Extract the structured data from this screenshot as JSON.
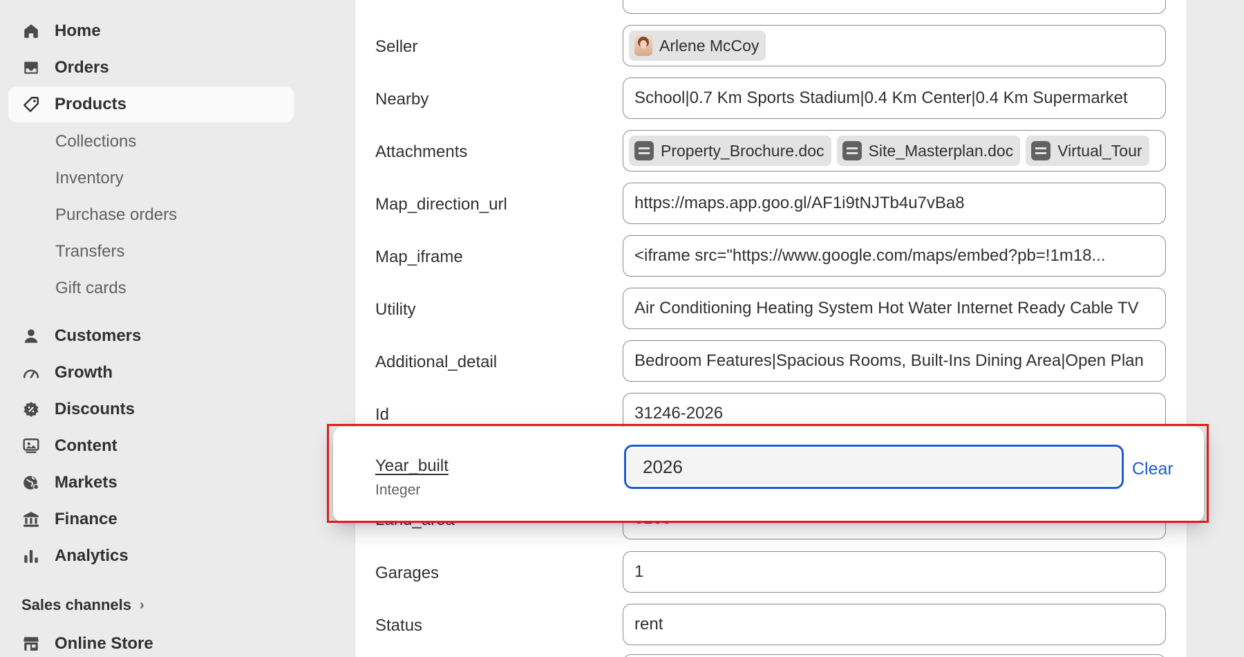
{
  "sidebar": {
    "main_items": [
      {
        "label": "Home",
        "icon": "home-icon"
      },
      {
        "label": "Orders",
        "icon": "inbox-icon"
      },
      {
        "label": "Products",
        "icon": "tag-icon",
        "active": true
      }
    ],
    "product_subitems": [
      "Collections",
      "Inventory",
      "Purchase orders",
      "Transfers",
      "Gift cards"
    ],
    "secondary_items": [
      {
        "label": "Customers",
        "icon": "person-icon"
      },
      {
        "label": "Growth",
        "icon": "gauge-icon"
      },
      {
        "label": "Discounts",
        "icon": "discount-badge-icon"
      },
      {
        "label": "Content",
        "icon": "image-icon"
      },
      {
        "label": "Markets",
        "icon": "globe-icon"
      },
      {
        "label": "Finance",
        "icon": "bank-icon"
      },
      {
        "label": "Analytics",
        "icon": "bar-chart-icon"
      }
    ],
    "sales_channels_label": "Sales channels",
    "online_store_label": "Online Store"
  },
  "fields": {
    "seller": {
      "label": "Seller",
      "value": "Arlene McCoy"
    },
    "nearby": {
      "label": "Nearby",
      "value": "School|0.7 Km Sports Stadium|0.4 Km Center|0.4 Km Supermarket"
    },
    "attachments": {
      "label": "Attachments",
      "files": [
        "Property_Brochure.doc",
        "Site_Masterplan.doc",
        "Virtual_Tour"
      ]
    },
    "map_direction_url": {
      "label": "Map_direction_url",
      "value": "https://maps.app.goo.gl/AF1i9tNJTb4u7vBa8"
    },
    "map_iframe": {
      "label": "Map_iframe",
      "value": "<iframe src=\"https://www.google.com/maps/embed?pb=!1m18..."
    },
    "utility": {
      "label": "Utility",
      "value": "Air Conditioning Heating System Hot Water Internet Ready Cable TV"
    },
    "additional_detail": {
      "label": "Additional_detail",
      "value": "Bedroom Features|Spacious Rooms, Built-Ins Dining Area|Open Plan"
    },
    "id": {
      "label": "Id",
      "value": "31246-2026"
    },
    "land_area": {
      "label": "Land_area",
      "value": "3200"
    },
    "garages": {
      "label": "Garages",
      "value": "1"
    },
    "status": {
      "label": "Status",
      "value": "rent"
    }
  },
  "popup": {
    "label": "Year_built",
    "type": "Integer",
    "value": "2026",
    "clear_label": "Clear",
    "highlight_color": "#e01b1b",
    "focus_color": "#1d5bd6"
  }
}
